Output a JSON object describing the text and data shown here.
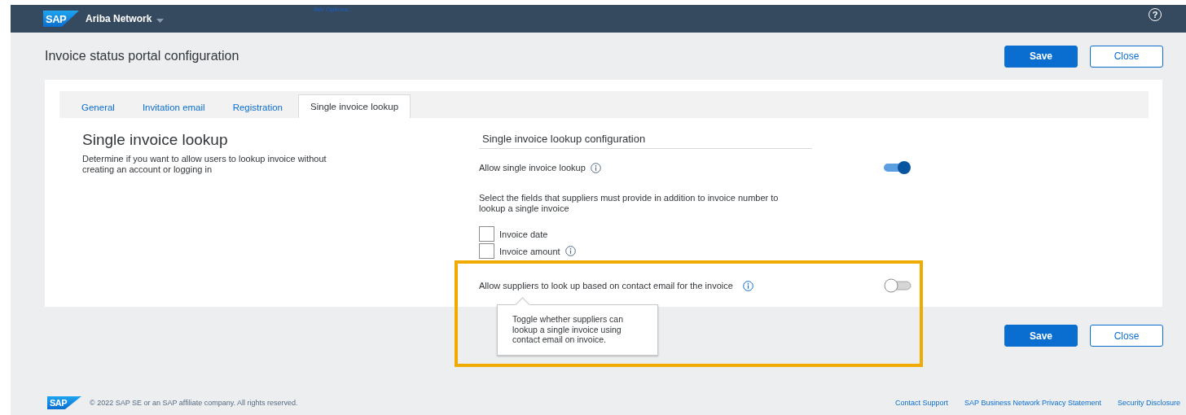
{
  "header": {
    "logo": "SAP",
    "product": "Ariba Network",
    "options_link": "AW Options...",
    "help": "?"
  },
  "page": {
    "title": "Invoice status portal configuration",
    "buttons": [
      {
        "label": "Save",
        "kind": "primary"
      },
      {
        "label": "Close",
        "kind": "secondary"
      }
    ]
  },
  "tabs": [
    {
      "label": "General",
      "selected": false
    },
    {
      "label": "Invitation email",
      "selected": false
    },
    {
      "label": "Registration",
      "selected": false
    },
    {
      "label": "Single invoice lookup",
      "selected": true
    }
  ],
  "section": {
    "heading": "Single invoice lookup",
    "description": "Determine if you want to allow users to lookup invoice without creating an account or logging in"
  },
  "config": {
    "heading": "Single invoice lookup configuration",
    "lookup_toggle": {
      "label": "Allow single invoice lookup",
      "on": true
    },
    "fields_intro": "Select the fields that suppliers must provide in addition to invoice number to lookup a single invoice",
    "fields": [
      {
        "label": "Invoice date",
        "checked": false,
        "info": false
      },
      {
        "label": "Invoice amount",
        "checked": false,
        "info": true
      }
    ],
    "email_toggle": {
      "label": "Allow suppliers to look up based on contact email for the invoice",
      "on": false
    }
  },
  "tooltip": {
    "text": "Toggle whether suppliers can lookup a single invoice using contact email on invoice."
  },
  "bottom_buttons": [
    {
      "label": "Save",
      "kind": "primary"
    },
    {
      "label": "Close",
      "kind": "secondary"
    }
  ],
  "footer": {
    "logo": "SAP",
    "copyright": "© 2022 SAP SE or an SAP affiliate company. All rights reserved.",
    "links": [
      "Contact Support",
      "SAP Business Network Privacy Statement",
      "Security Disclosure"
    ]
  }
}
